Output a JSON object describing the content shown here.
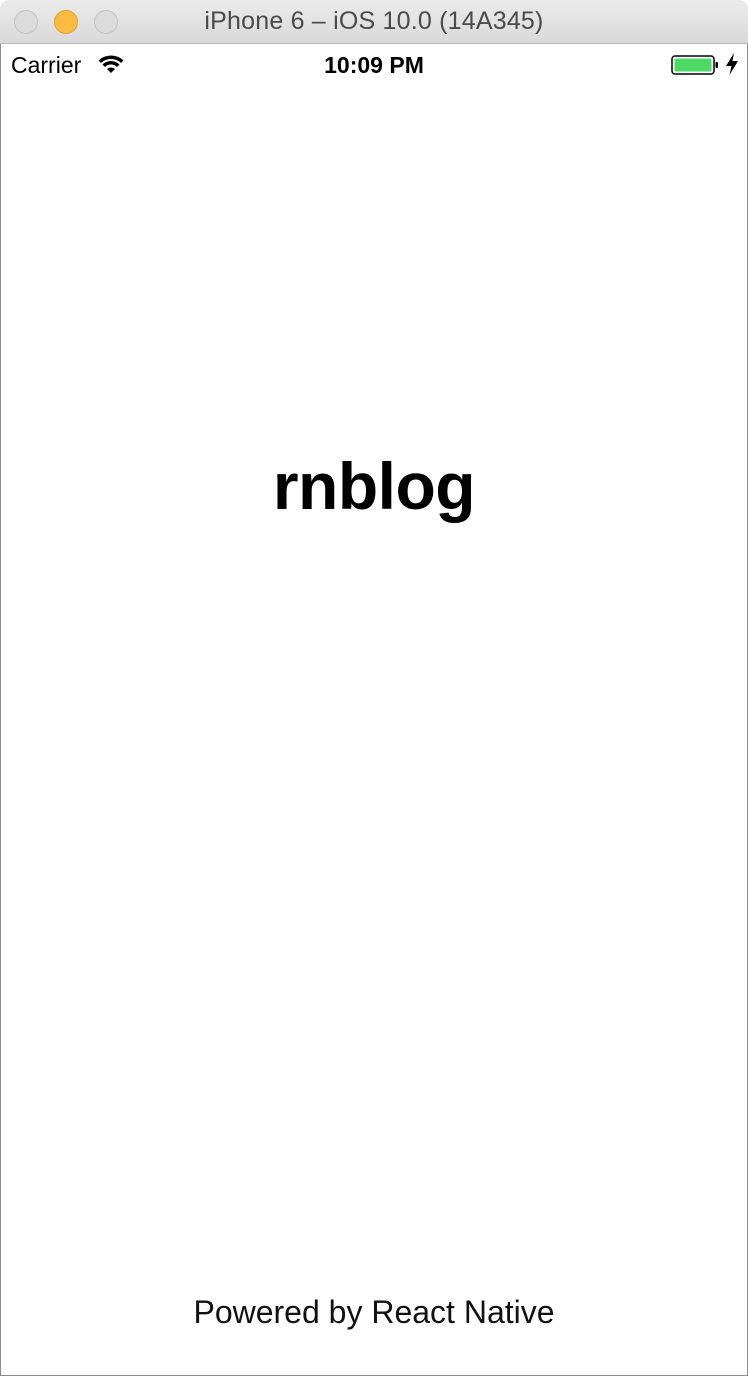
{
  "window": {
    "title": "iPhone 6 – iOS 10.0 (14A345)"
  },
  "statusbar": {
    "carrier": "Carrier",
    "time": "10:09 PM",
    "battery_color": "#4cd964"
  },
  "app": {
    "title": "rnblog",
    "footer": "Powered by React Native"
  },
  "colors": {
    "minimize_button": "#fdbc40",
    "inactive_button": "#dcdcdc"
  }
}
